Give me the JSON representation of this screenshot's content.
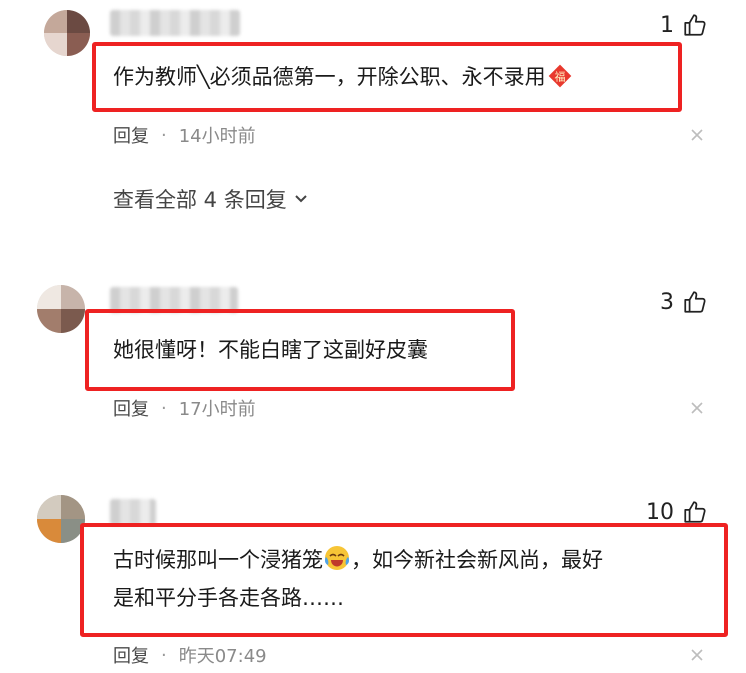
{
  "comments": [
    {
      "likes": "1",
      "text": "作为教师╲必须品德第一，开除公职、永不录用",
      "reply_label": "回复",
      "separator": "·",
      "time": "14小时前",
      "view_all": "查看全部 4 条回复",
      "badge_char": "福"
    },
    {
      "likes": "3",
      "text": "她很懂呀！不能白瞎了这副好皮囊",
      "reply_label": "回复",
      "separator": "·",
      "time": "17小时前"
    },
    {
      "likes": "10",
      "text_line1a": "古时候那叫一个浸猪笼",
      "text_line1b": "，如今新社会新风尚，最好",
      "text_line2": "是和平分手各走各路……",
      "reply_label": "回复",
      "separator": "·",
      "time": "昨天07:49"
    }
  ],
  "colors": {
    "highlight_border": "#ee2222",
    "badge_red": "#e8392e",
    "muted_text": "#8a8a8a"
  },
  "icons": [
    "thumbs-up-icon",
    "close-icon",
    "chevron-down-icon",
    "fu-badge-icon",
    "laughing-tears-emoji"
  ]
}
